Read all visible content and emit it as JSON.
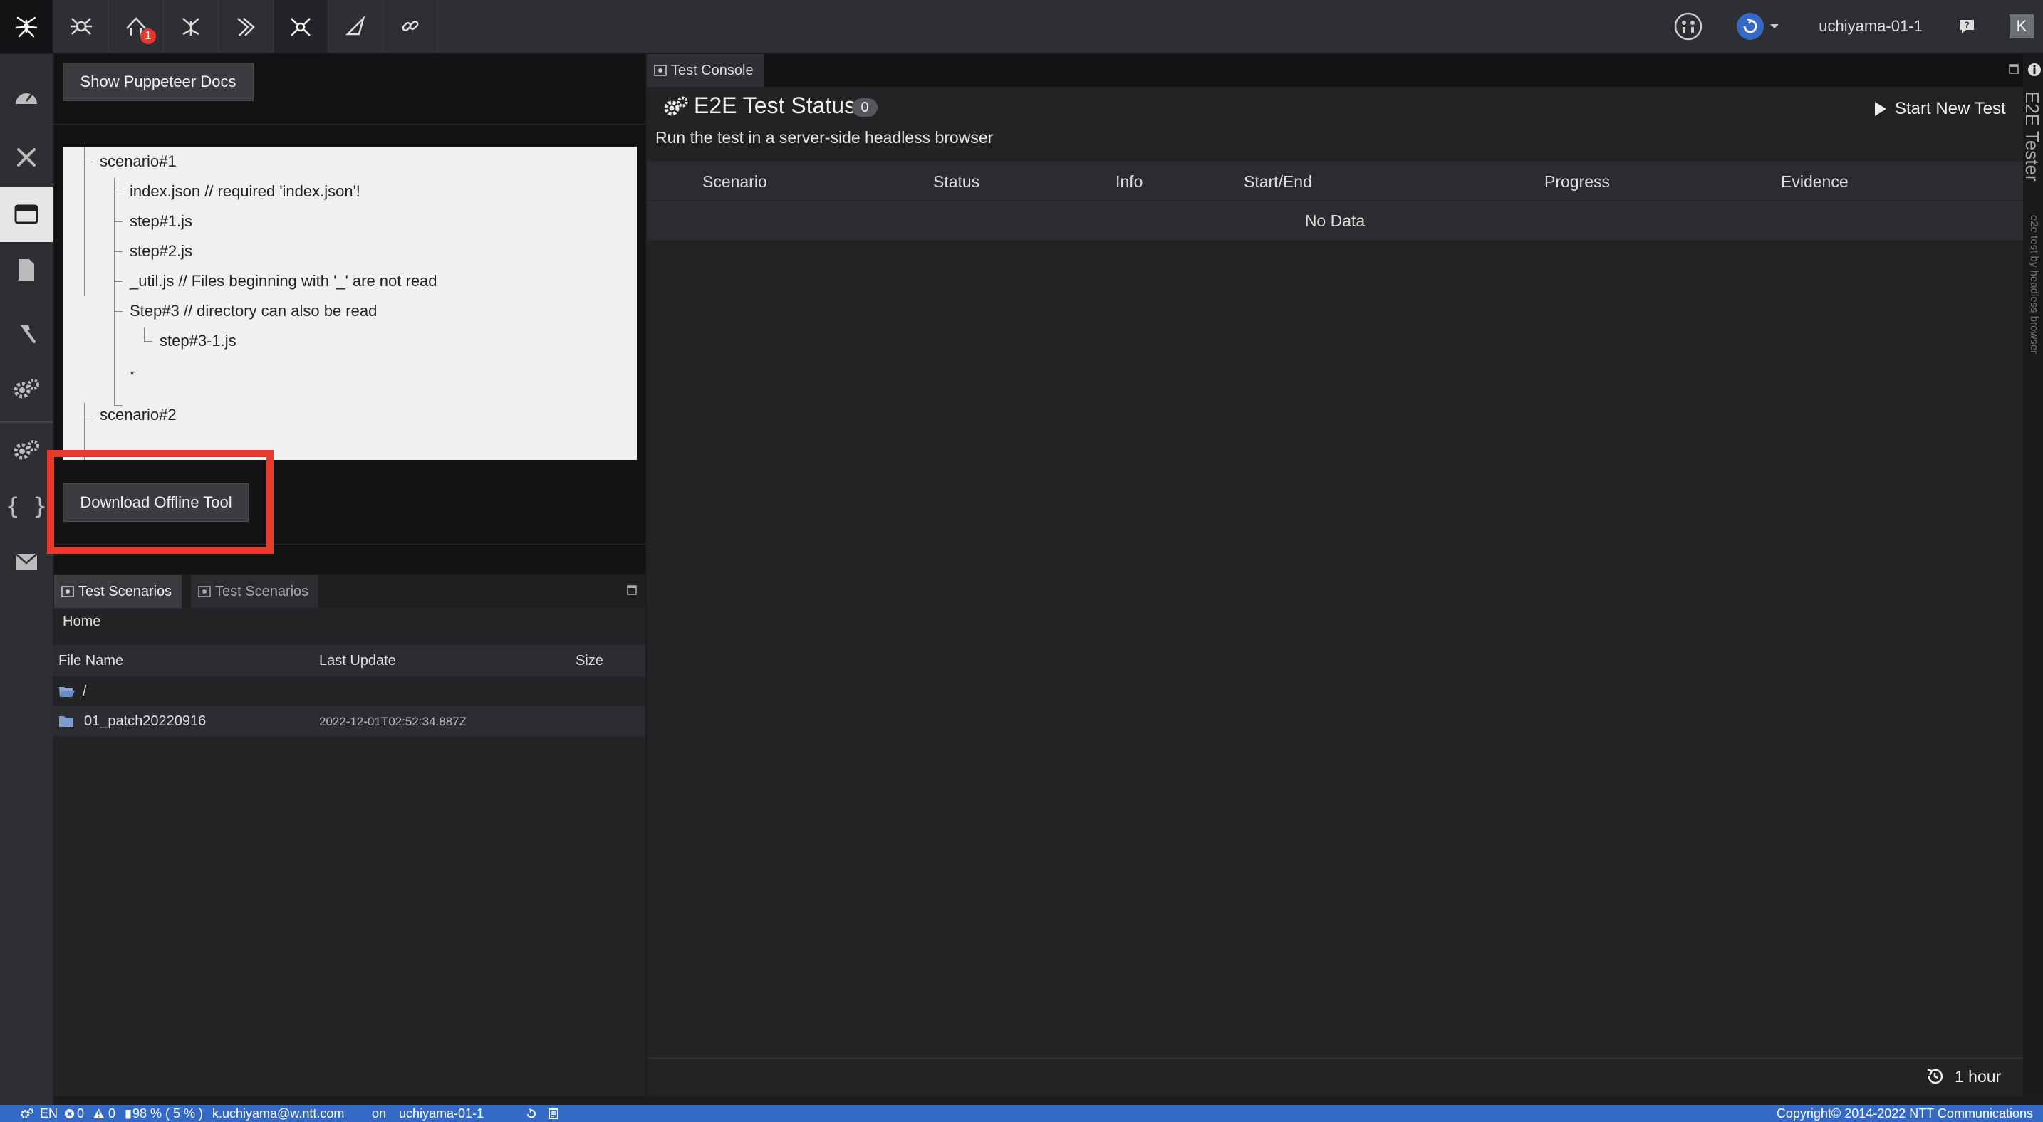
{
  "topbar": {
    "notification_count": "1",
    "username": "uchiyama-01-1",
    "avatar_letter": "K"
  },
  "docs_panel": {
    "show_docs_button": "Show Puppeteer Docs",
    "tree": [
      "scenario#1",
      "index.json // required 'index.json'!",
      "step#1.js",
      "step#2.js",
      "_util.js // Files beginning with '_' are not read",
      "Step#3 // directory can also be read",
      "step#3-1.js",
      "*",
      "scenario#2"
    ],
    "download_button": "Download Offline Tool"
  },
  "scenarios_panel": {
    "tabs": [
      "Test Scenarios",
      "Test Scenarios"
    ],
    "breadcrumb": "Home",
    "columns": [
      "File Name",
      "Last Update",
      "Size"
    ],
    "rows": [
      {
        "name": "/",
        "updated": "",
        "size": ""
      },
      {
        "name": "01_patch20220916",
        "updated": "2022-12-01T02:52:34.887Z",
        "size": ""
      }
    ]
  },
  "console": {
    "tab_label": "Test Console",
    "title": "E2E Test Status",
    "count": "0",
    "start_button": "Start New Test",
    "subtitle": "Run the test in a server-side headless browser",
    "columns": [
      "Scenario",
      "Status",
      "Info",
      "Start/End",
      "Progress",
      "Evidence"
    ],
    "empty_text": "No Data",
    "refresh_interval": "1 hour"
  },
  "side_strip": {
    "title": "E2E Tester",
    "subtitle": "e2e test by headless browser"
  },
  "statusbar": {
    "lang": "EN",
    "errors": "0",
    "warnings": "0",
    "battery": "98 % ( 5 % )",
    "email": "k.uchiyama@w.ntt.com",
    "on": "on",
    "host": "uchiyama-01-1",
    "copyright": "Copyright© 2014-2022 NTT Communications"
  },
  "colors": {
    "accent_blue": "#3569c6",
    "highlight_red": "#e8392a",
    "badge_red": "#e03b2e"
  }
}
